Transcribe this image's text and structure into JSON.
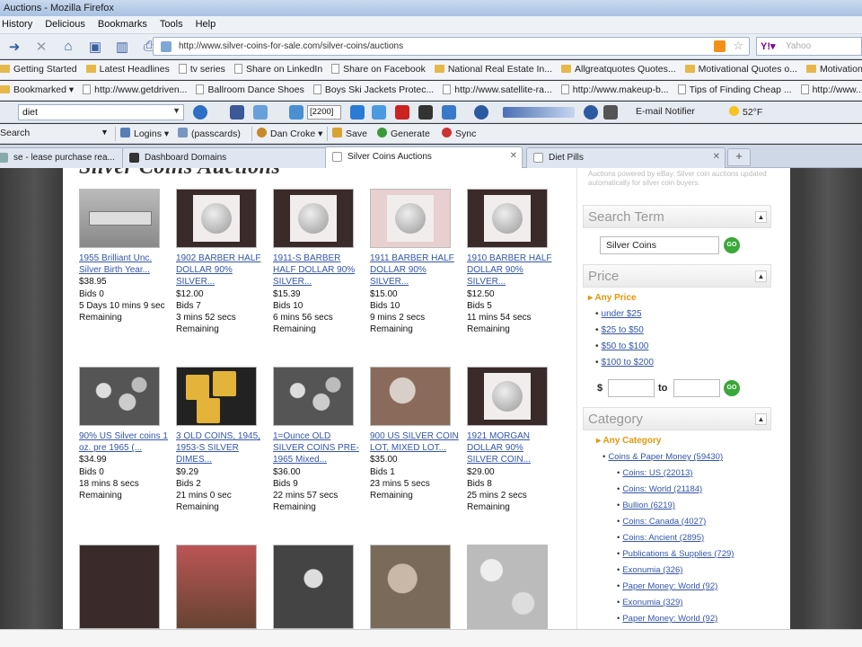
{
  "window": {
    "title": "Auctions - Mozilla Firefox"
  },
  "menu": [
    "History",
    "Delicious",
    "Bookmarks",
    "Tools",
    "Help"
  ],
  "nav": {
    "url": "http://www.silver-coins-for-sale.com/silver-coins/auctions",
    "search_placeholder": "Yahoo"
  },
  "bookmarks_row1": [
    {
      "label": "Getting Started",
      "icon": "folder-icon"
    },
    {
      "label": "Latest Headlines",
      "icon": "folder-icon"
    },
    {
      "label": "tv series",
      "icon": "page-icon"
    },
    {
      "label": "Share on LinkedIn",
      "icon": "page-icon"
    },
    {
      "label": "Share on Facebook",
      "icon": "page-icon"
    },
    {
      "label": "National Real Estate In...",
      "icon": "folder-icon"
    },
    {
      "label": "Allgreatquotes Quotes...",
      "icon": "folder-icon"
    },
    {
      "label": "Motivational Quotes o...",
      "icon": "folder-icon"
    },
    {
      "label": "Motivational Quotes fro...",
      "icon": "folder-icon"
    }
  ],
  "bookmarks_row2": [
    {
      "label": "Bookmarked ▾",
      "icon": "folder-icon"
    },
    {
      "label": "http://www.getdriven...",
      "icon": "page-icon"
    },
    {
      "label": "Ballroom Dance Shoes",
      "icon": "page-icon"
    },
    {
      "label": "Boys Ski Jackets Protec...",
      "icon": "page-icon"
    },
    {
      "label": "http://www.satellite-ra...",
      "icon": "page-icon"
    },
    {
      "label": "http://www.makeup-b...",
      "icon": "page-icon"
    },
    {
      "label": "Tips of Finding Cheap ...",
      "icon": "page-icon"
    },
    {
      "label": "http://www...",
      "icon": "page-icon"
    }
  ],
  "toolbar3": {
    "search_value": "diet",
    "count": "[2200]",
    "email": "E-mail Notifier",
    "weather": "52°F"
  },
  "toolbar4": {
    "search": "Search",
    "logins": "Logins",
    "passcards": "(passcards)",
    "user": "Dan Croke",
    "save": "Save",
    "generate": "Generate",
    "sync": "Sync"
  },
  "tabs": [
    {
      "label": "se - lease purchase rea...",
      "active": false
    },
    {
      "label": "Dashboard Domains",
      "active": false
    },
    {
      "label": "Silver Coins Auctions",
      "active": true
    },
    {
      "label": "Diet Pills",
      "active": false
    }
  ],
  "page": {
    "title": "Silver Coins Auctions"
  },
  "items": [
    {
      "title": "1955 Brilliant Unc. Silver Birth Year...",
      "price": "$38.95",
      "bids": "Bids 0",
      "time": "5 Days 10 mins 9 sec Remaining",
      "thumb": "coin-set"
    },
    {
      "title": "1902 BARBER HALF DOLLAR 90% SILVER...",
      "price": "$12.00",
      "bids": "Bids 7",
      "time": "3 mins 52 secs Remaining",
      "thumb": "coin-holder"
    },
    {
      "title": "1911-S BARBER HALF DOLLAR 90% SILVER...",
      "price": "$15.39",
      "bids": "Bids 10",
      "time": "6 mins 56 secs Remaining",
      "thumb": "coin-large"
    },
    {
      "title": "1911 BARBER HALF DOLLAR 90% SILVER...",
      "price": "$15.00",
      "bids": "Bids 10",
      "time": "9 mins 2 secs Remaining",
      "thumb": "coin-pink"
    },
    {
      "title": "1910 BARBER HALF DOLLAR 90% SILVER...",
      "price": "$12.50",
      "bids": "Bids 5",
      "time": "11 mins 54 secs Remaining",
      "thumb": "coin-holder"
    },
    {
      "title": "90% US Silver coins 1 oz. pre 1965 (...",
      "price": "$34.99",
      "bids": "Bids 0",
      "time": "18 mins 8 secs Remaining",
      "thumb": "coin-pile"
    },
    {
      "title": "3 OLD COINS, 1945, 1953-S SILVER DIMES...",
      "price": "$9.29",
      "bids": "Bids 2",
      "time": "21 mins 0 sec Remaining",
      "thumb": "coin-gold"
    },
    {
      "title": "1=Ounce OLD SILVER COINS PRE-1965 Mixed...",
      "price": "$36.00",
      "bids": "Bids 9",
      "time": "22 mins 57 secs Remaining",
      "thumb": "coin-pile"
    },
    {
      "title": "900 US SILVER COIN LOT, MIXED LOT...",
      "price": "$35.00",
      "bids": "Bids 1",
      "time": "23 mins 5 secs Remaining",
      "thumb": "coin-lot"
    },
    {
      "title": "1921 MORGAN DOLLAR 90% SILVER COIN...",
      "price": "$29.00",
      "bids": "Bids 8",
      "time": "25 mins 2 secs Remaining",
      "thumb": "coin-holder"
    }
  ],
  "sidebar": {
    "note": "Auctions powered by eBay. Silver coin auctions updated automatically for silver coin buyers.",
    "search_term": {
      "heading": "Search Term",
      "value": "Silver Coins",
      "go": "GO"
    },
    "price": {
      "heading": "Price",
      "any": "Any Price",
      "ranges": [
        "under $25",
        "$25 to $50",
        "$50 to $100",
        "$100 to $200"
      ],
      "from_label": "$",
      "to_label": "to",
      "go": "GO"
    },
    "category": {
      "heading": "Category",
      "any": "Any Category",
      "top": "Coins & Paper Money (59430)",
      "subs": [
        "Coins: US (22013)",
        "Coins: World (21184)",
        "Bullion (6219)",
        "Coins: Canada (4027)",
        "Coins: Ancient (2895)",
        "Publications & Supplies (729)",
        "Exonumia (326)",
        "Paper Money: World (92)",
        "Exonumia (329)",
        "Paper Money: World (92)"
      ]
    }
  },
  "colors": {
    "link": "#3355aa",
    "accent": "#e6960a",
    "go": "#3aa83a"
  }
}
